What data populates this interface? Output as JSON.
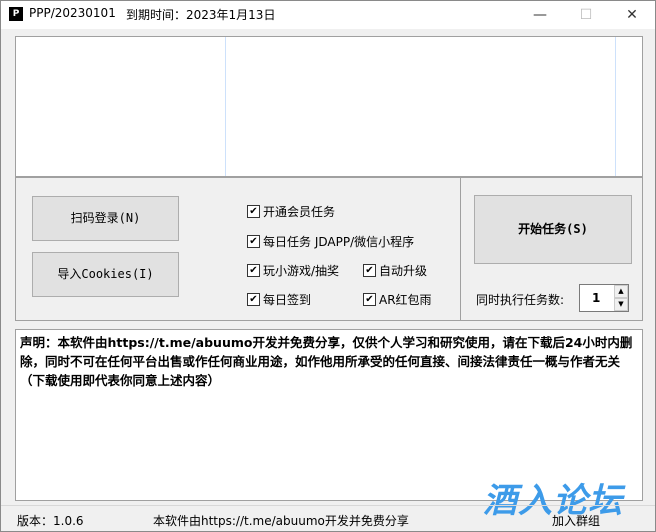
{
  "window": {
    "title": "PPP/20230101",
    "expire": "到期时间：2023年1月13日",
    "icon": "P",
    "minimize": "—",
    "maximize": "☐",
    "close": "✕"
  },
  "buttons": {
    "scan_login": "扫码登录(N)",
    "import_cookies": "导入Cookies(I)",
    "start": "开始任务(S)"
  },
  "checkboxes": [
    {
      "label": "开通会员任务",
      "checked": true
    },
    {
      "label": "每日任务 JDAPP/微信小程序",
      "checked": true
    },
    {
      "label": "玩小游戏/抽奖",
      "checked": true
    },
    {
      "label": "自动升级",
      "checked": true
    },
    {
      "label": "每日签到",
      "checked": true
    },
    {
      "label": "AR红包雨",
      "checked": true
    }
  ],
  "concurrency": {
    "label": "同时执行任务数:",
    "value": "1"
  },
  "notice": "声明：本软件由https://t.me/abuumo开发并免费分享，仅供个人学习和研究使用，请在下载后24小时内删除，同时不可在任何平台出售或作任何商业用途，如作他用所承受的任何直接、间接法律责任一概与作者无关（下载使用即代表你同意上述内容）",
  "watermark": "酒入论坛",
  "status": {
    "version": "版本：1.0.6",
    "share": "本软件由https://t.me/abuumo开发并免费分享",
    "join": "加入群组"
  },
  "colors": {
    "watermark": "#3d9be9",
    "column_line": "#cde1fb"
  }
}
